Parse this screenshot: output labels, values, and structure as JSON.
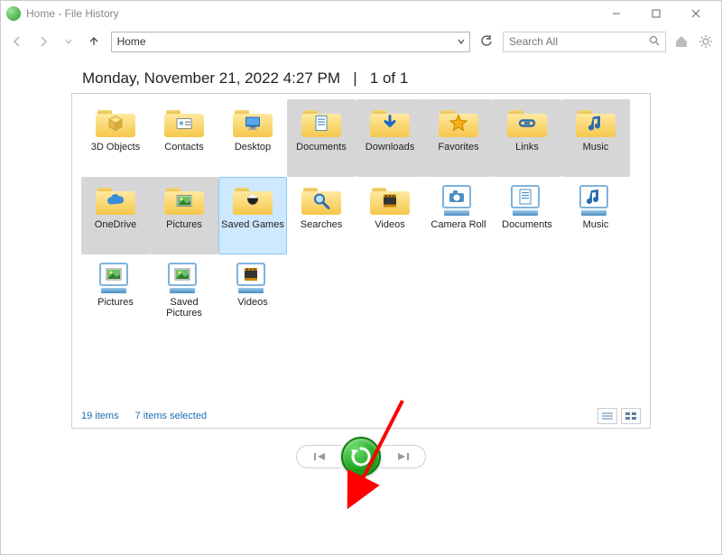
{
  "window": {
    "title": "Home - File History"
  },
  "nav": {
    "location": "Home"
  },
  "search": {
    "placeholder": "Search All"
  },
  "header": {
    "snapshot": "Monday, November 21, 2022 4:27 PM",
    "sep": "|",
    "count": "1 of 1"
  },
  "items": [
    {
      "label": "3D Objects",
      "type": "folder",
      "overlay": "cube",
      "selected": false
    },
    {
      "label": "Contacts",
      "type": "folder",
      "overlay": "card",
      "selected": false
    },
    {
      "label": "Desktop",
      "type": "folder",
      "overlay": "desk",
      "selected": false
    },
    {
      "label": "Documents",
      "type": "folder",
      "overlay": "doc",
      "selected": true
    },
    {
      "label": "Downloads",
      "type": "folder",
      "overlay": "down",
      "selected": true
    },
    {
      "label": "Favorites",
      "type": "folder",
      "overlay": "star",
      "selected": true
    },
    {
      "label": "Links",
      "type": "folder",
      "overlay": "link",
      "selected": true
    },
    {
      "label": "Music",
      "type": "folder",
      "overlay": "note",
      "selected": true
    },
    {
      "label": "OneDrive",
      "type": "folder",
      "overlay": "cloud",
      "selected": true
    },
    {
      "label": "Pictures",
      "type": "folder",
      "overlay": "pic",
      "selected": true
    },
    {
      "label": "Saved Games",
      "type": "folder",
      "overlay": "game",
      "selected": "blue"
    },
    {
      "label": "Searches",
      "type": "folder",
      "overlay": "mag",
      "selected": false
    },
    {
      "label": "Videos",
      "type": "folder",
      "overlay": "film",
      "selected": false
    },
    {
      "label": "Camera Roll",
      "type": "library",
      "overlay": "cam",
      "selected": false
    },
    {
      "label": "Documents",
      "type": "library",
      "overlay": "doc",
      "selected": false
    },
    {
      "label": "Music",
      "type": "library",
      "overlay": "note",
      "selected": false
    },
    {
      "label": "Pictures",
      "type": "library",
      "overlay": "pic",
      "selected": false
    },
    {
      "label": "Saved Pictures",
      "type": "library",
      "overlay": "pic",
      "selected": false
    },
    {
      "label": "Videos",
      "type": "library",
      "overlay": "film",
      "selected": false
    }
  ],
  "status": {
    "count": "19 items",
    "selection": "7 items selected"
  },
  "colors": {
    "restore": "#1aa31a",
    "selectBlue": "#cde8ff",
    "selectGrey": "#d6d6d6"
  }
}
